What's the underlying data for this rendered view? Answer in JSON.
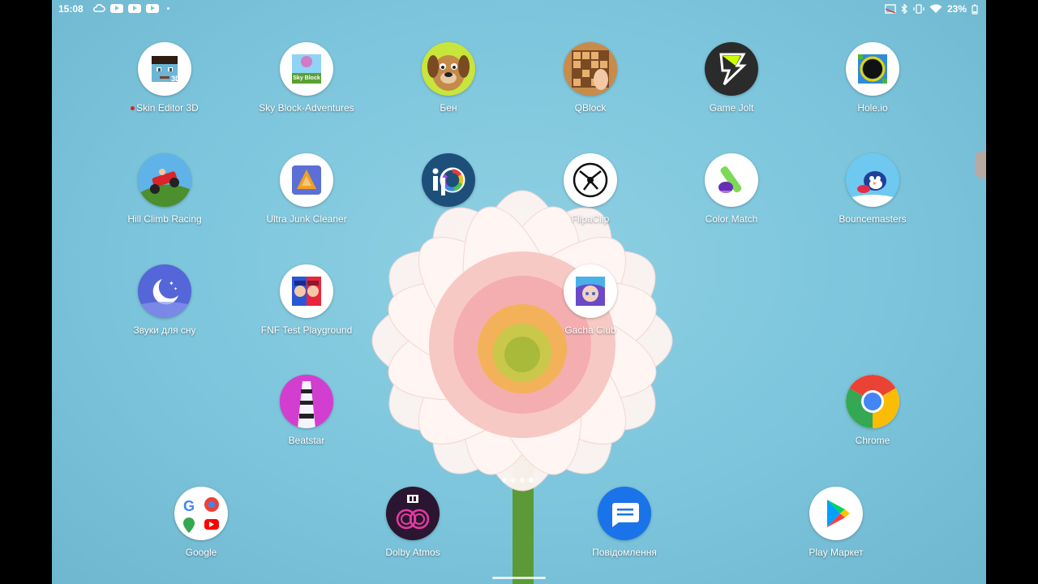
{
  "status": {
    "time": "15:08",
    "battery": "23%",
    "icons": [
      "cloud-icon",
      "youtube-icon",
      "youtube-icon",
      "youtube-icon",
      "dot-icon",
      "cast-icon",
      "bluetooth-icon",
      "vibrate-icon",
      "wifi-icon",
      "battery-icon"
    ]
  },
  "apps": [
    {
      "name": "skin-editor-3d",
      "label": "Skin Editor 3D",
      "bg": "#ffffff",
      "badge": true
    },
    {
      "name": "sky-block-adventures",
      "label": "Sky Block-Adventures",
      "bg": "#ffffff"
    },
    {
      "name": "ben",
      "label": "Бен",
      "bg": "#c7e53b"
    },
    {
      "name": "qblock",
      "label": "QBlock",
      "bg": "#c98b4a"
    },
    {
      "name": "game-jolt",
      "label": "Game Jolt",
      "bg": "#2b2b2b"
    },
    {
      "name": "hole-io",
      "label": "Hole.io",
      "bg": "#ffffff"
    },
    {
      "name": "hill-climb-racing",
      "label": "Hill Climb Racing",
      "bg": "#5fb3e8"
    },
    {
      "name": "ultra-junk-cleaner",
      "label": "Ultra Junk Cleaner",
      "bg": "#ffffff"
    },
    {
      "name": "ibis-paint",
      "label": "",
      "bg": "#1d4f7a"
    },
    {
      "name": "flipaclip",
      "label": "FlipaClip",
      "bg": "#ffffff"
    },
    {
      "name": "color-match",
      "label": "Color Match",
      "bg": "#ffffff"
    },
    {
      "name": "bouncemasters",
      "label": "Bouncemasters",
      "bg": "#6ec8f0"
    },
    {
      "name": "sleep-sounds",
      "label": "Звуки для сну",
      "bg": "#5566d8"
    },
    {
      "name": "fnf-test-playground",
      "label": "FNF Test Playground",
      "bg": "#ffffff"
    },
    {
      "name": "gacha-club",
      "label": "Gacha Club",
      "bg": "#ffffff"
    },
    {
      "name": "beatstar",
      "label": "Beatstar",
      "bg": "#d23fd0"
    },
    {
      "name": "chrome",
      "label": "Chrome",
      "bg": "#ffffff"
    }
  ],
  "dock": [
    {
      "name": "google-folder",
      "label": "Google",
      "bg": "#ffffff"
    },
    {
      "name": "dolby-atmos",
      "label": "Dolby Atmos",
      "bg": "#2a1630"
    },
    {
      "name": "messages",
      "label": "Повідомлення",
      "bg": "#1a73e8"
    },
    {
      "name": "play-market",
      "label": "Play Маркет",
      "bg": "#ffffff"
    }
  ],
  "pager": {
    "pages": 4,
    "active": 3
  }
}
